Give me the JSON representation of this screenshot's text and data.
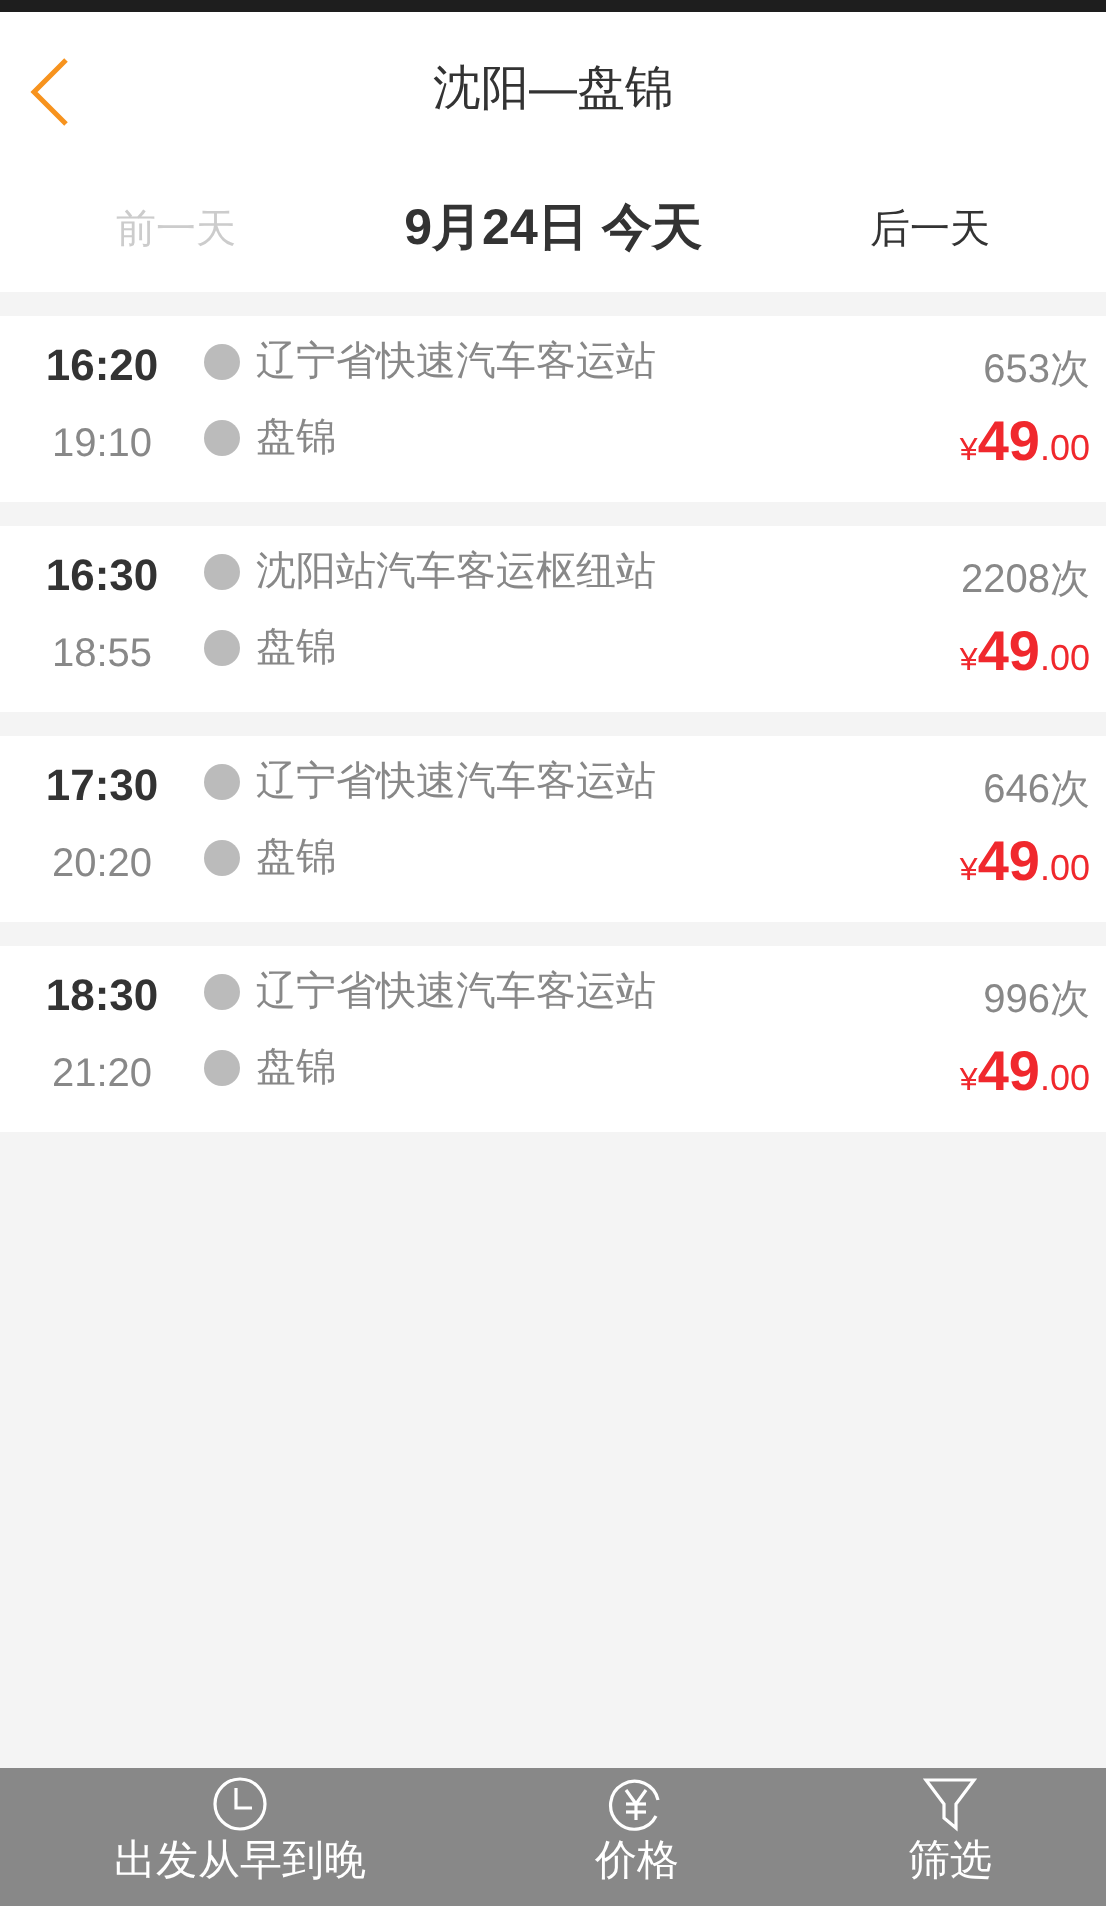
{
  "header": {
    "title": "沈阳—盘锦"
  },
  "date_nav": {
    "previous": {
      "label": "前一天",
      "disabled": true
    },
    "current": "9月24日 今天",
    "next": {
      "label": "后一天",
      "disabled": false
    }
  },
  "trips": [
    {
      "depart": "16:20",
      "arrive": "19:10",
      "from": "辽宁省快速汽车客运站",
      "to": "盘锦",
      "count": "653次",
      "price": {
        "symbol": "¥",
        "whole": "49",
        "fraction": ".00"
      }
    },
    {
      "depart": "16:30",
      "arrive": "18:55",
      "from": "沈阳站汽车客运枢纽站",
      "to": "盘锦",
      "count": "2208次",
      "price": {
        "symbol": "¥",
        "whole": "49",
        "fraction": ".00"
      }
    },
    {
      "depart": "17:30",
      "arrive": "20:20",
      "from": "辽宁省快速汽车客运站",
      "to": "盘锦",
      "count": "646次",
      "price": {
        "symbol": "¥",
        "whole": "49",
        "fraction": ".00"
      }
    },
    {
      "depart": "18:30",
      "arrive": "21:20",
      "from": "辽宁省快速汽车客运站",
      "to": "盘锦",
      "count": "996次",
      "price": {
        "symbol": "¥",
        "whole": "49",
        "fraction": ".00"
      }
    }
  ],
  "bottom_bar": [
    {
      "kind": "clock",
      "label": "出发从早到晚"
    },
    {
      "kind": "yen",
      "label": "价格"
    },
    {
      "kind": "filter",
      "label": "筛选"
    }
  ]
}
